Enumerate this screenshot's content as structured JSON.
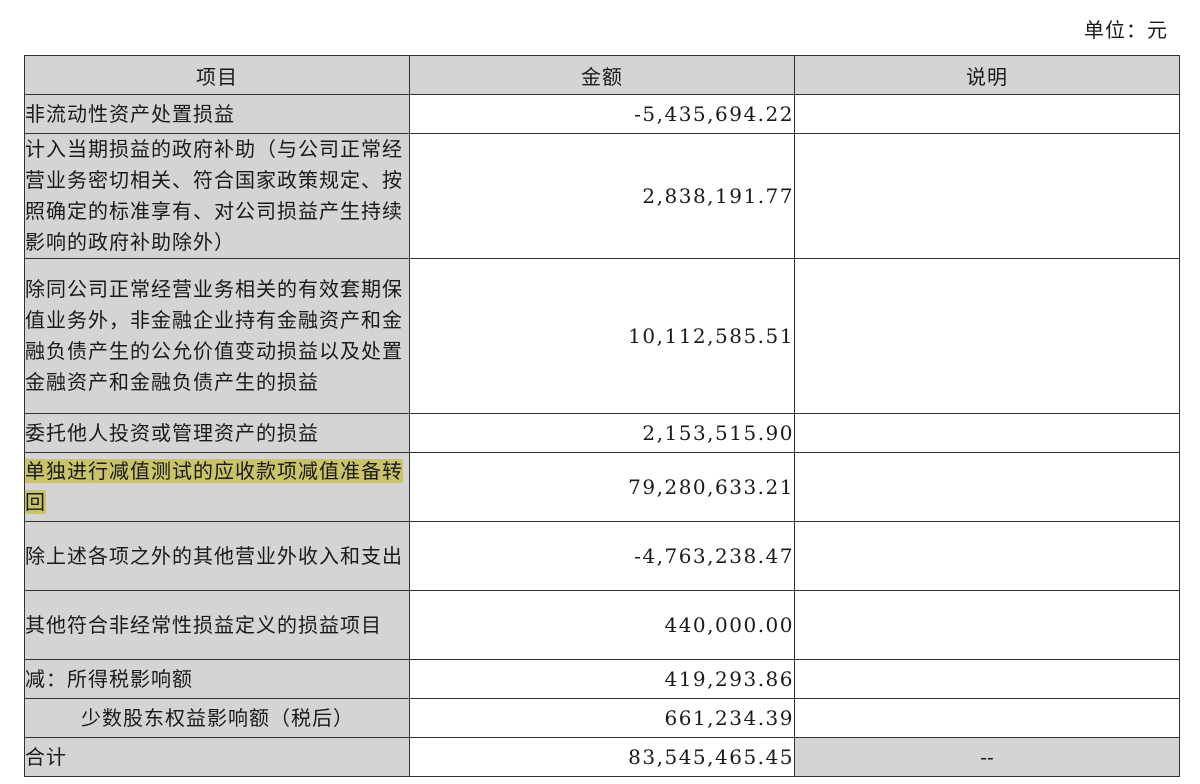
{
  "unit_label": "单位：元",
  "table": {
    "headers": {
      "item": "项目",
      "amount": "金额",
      "note": "说明"
    },
    "rows": [
      {
        "item": "非流动性资产处置损益",
        "amount": "-5,435,694.22",
        "note": ""
      },
      {
        "item": "计入当期损益的政府补助（与公司正常经营业务密切相关、符合国家政策规定、按照确定的标准享有、对公司损益产生持续影响的政府补助除外）",
        "amount": "2,838,191.77",
        "note": ""
      },
      {
        "item": "除同公司正常经营业务相关的有效套期保值业务外，非金融企业持有金融资产和金融负债产生的公允价值变动损益以及处置金融资产和金融负债产生的损益",
        "amount": "10,112,585.51",
        "note": ""
      },
      {
        "item": "委托他人投资或管理资产的损益",
        "amount": "2,153,515.90",
        "note": ""
      },
      {
        "item": "单独进行减值测试的应收款项减值准备转回",
        "amount": "79,280,633.21",
        "note": ""
      },
      {
        "item": "除上述各项之外的其他营业外收入和支出",
        "amount": "-4,763,238.47",
        "note": ""
      },
      {
        "item": "其他符合非经常性损益定义的损益项目",
        "amount": "440,000.00",
        "note": ""
      },
      {
        "item": "减：所得税影响额",
        "amount": "419,293.86",
        "note": ""
      },
      {
        "item": "少数股东权益影响额（税后）",
        "amount": "661,234.39",
        "note": ""
      },
      {
        "item": "合计",
        "amount": "83,545,465.45",
        "note": "--"
      }
    ]
  },
  "highlight_color": "#c9c36a",
  "cell_shade_color": "#d4d4d4"
}
